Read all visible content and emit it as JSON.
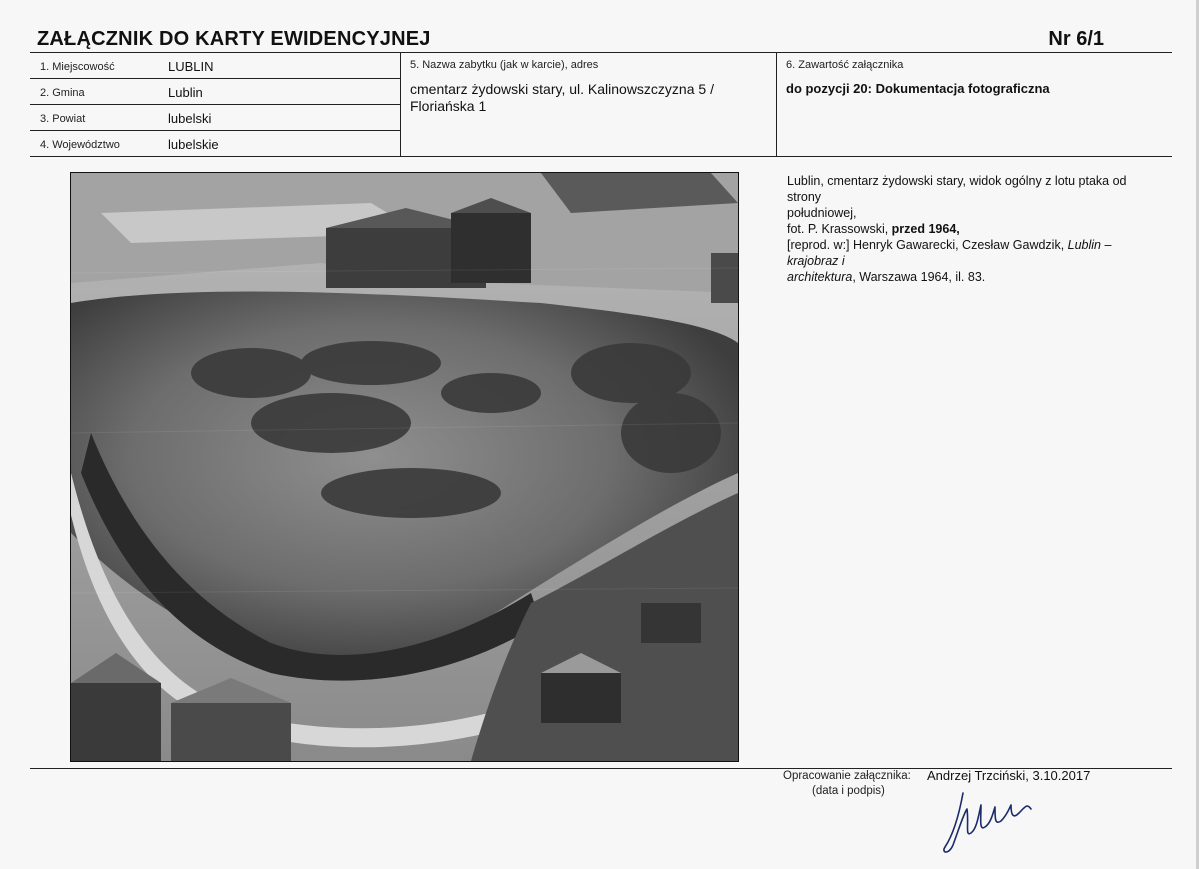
{
  "header": {
    "title": "ZAŁĄCZNIK DO KARTY EWIDENCYJNEJ",
    "number": "Nr 6/1"
  },
  "fields": {
    "miejscowosc": {
      "label": "1. Miejscowość",
      "value": "LUBLIN"
    },
    "gmina": {
      "label": "2. Gmina",
      "value": "Lublin"
    },
    "powiat": {
      "label": "3. Powiat",
      "value": "lubelski"
    },
    "wojewodztwo": {
      "label": "4. Województwo",
      "value": "lubelskie"
    },
    "nazwa": {
      "label": "5. Nazwa zabytku (jak w karcie), adres",
      "line1": "cmentarz żydowski stary, ul. Kalinowszczyzna 5 /",
      "line2": "Floriańska 1"
    },
    "zawartosc": {
      "label": "6. Zawartość załącznika",
      "value": "do pozycji 20: Dokumentacja fotograficzna"
    }
  },
  "description": {
    "line1": "Lublin, cmentarz żydowski stary, widok ogólny z lotu ptaka od strony",
    "line2": "południowej,",
    "line3_prefix": "fot. P. Krassowski, ",
    "line3_bold": "przed 1964,",
    "line4_prefix": "[reprod. w:] Henryk Gawarecki, Czesław Gawdzik, ",
    "line4_italic": "Lublin – krajobraz i",
    "line5_italic": "architektura",
    "line5_suffix": ", Warszawa 1964, il. 83."
  },
  "footer": {
    "label1": "Opracowanie załącznika:",
    "label2": "(data i podpis)",
    "author": "Andrzej Trzciński, 3.10.2017"
  },
  "photo": {
    "subject": "aerial-photo",
    "tone": "grayscale"
  }
}
